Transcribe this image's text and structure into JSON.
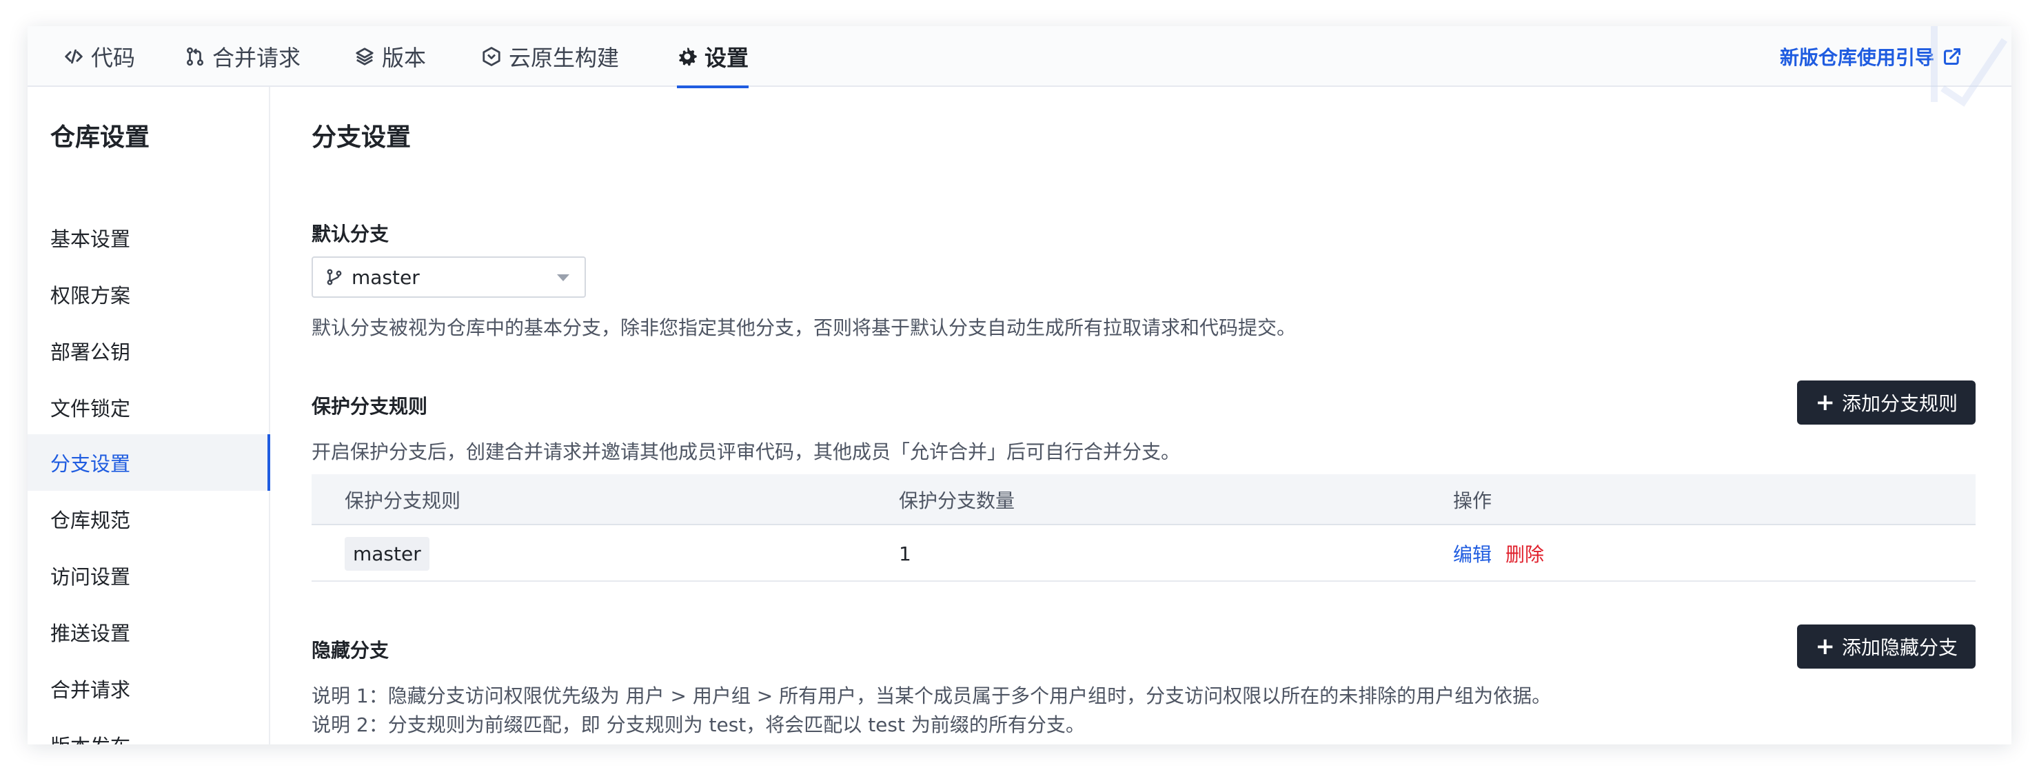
{
  "tabs": [
    {
      "label": "代码",
      "icon": "code-icon",
      "active": false
    },
    {
      "label": "合并请求",
      "icon": "merge-request-icon",
      "active": false
    },
    {
      "label": "版本",
      "icon": "layers-icon",
      "active": false
    },
    {
      "label": "云原生构建",
      "icon": "cloud-build-icon",
      "active": false
    },
    {
      "label": "设置",
      "icon": "gear-icon",
      "active": true
    }
  ],
  "guide_link": {
    "label": "新版仓库使用引导",
    "icon": "external-link-icon"
  },
  "sidebar": {
    "title": "仓库设置",
    "items": [
      {
        "label": "基本设置"
      },
      {
        "label": "权限方案"
      },
      {
        "label": "部署公钥"
      },
      {
        "label": "文件锁定"
      },
      {
        "label": "分支设置",
        "active": true
      },
      {
        "label": "仓库规范"
      },
      {
        "label": "访问设置"
      },
      {
        "label": "推送设置"
      },
      {
        "label": "合并请求"
      },
      {
        "label": "版本发布"
      }
    ]
  },
  "main": {
    "title": "分支设置",
    "default_branch": {
      "label": "默认分支",
      "value": "master",
      "description": "默认分支被视为仓库中的基本分支，除非您指定其他分支，否则将基于默认分支自动生成所有拉取请求和代码提交。"
    },
    "protected": {
      "label": "保护分支规则",
      "add_button": "添加分支规则",
      "description": "开启保护分支后，创建合并请求并邀请其他成员评审代码，其他成员「允许合并」后可自行合并分支。",
      "columns": [
        "保护分支规则",
        "保护分支数量",
        "操作"
      ],
      "rows": [
        {
          "rule": "master",
          "count": "1",
          "edit": "编辑",
          "delete": "删除"
        }
      ]
    },
    "hidden": {
      "label": "隐藏分支",
      "add_button": "添加隐藏分支",
      "note1": "说明 1：隐藏分支访问权限优先级为 用户 > 用户组 > 所有用户，当某个成员属于多个用户组时，分支访问权限以所在的未排除的用户组为依据。",
      "note2": "说明 2：分支规则为前缀匹配，即 分支规则为 test，将会匹配以 test 为前缀的所有分支。"
    }
  },
  "colors": {
    "accent": "#1f5ce0",
    "danger": "#e0202c",
    "dark_button": "#1f2633"
  }
}
